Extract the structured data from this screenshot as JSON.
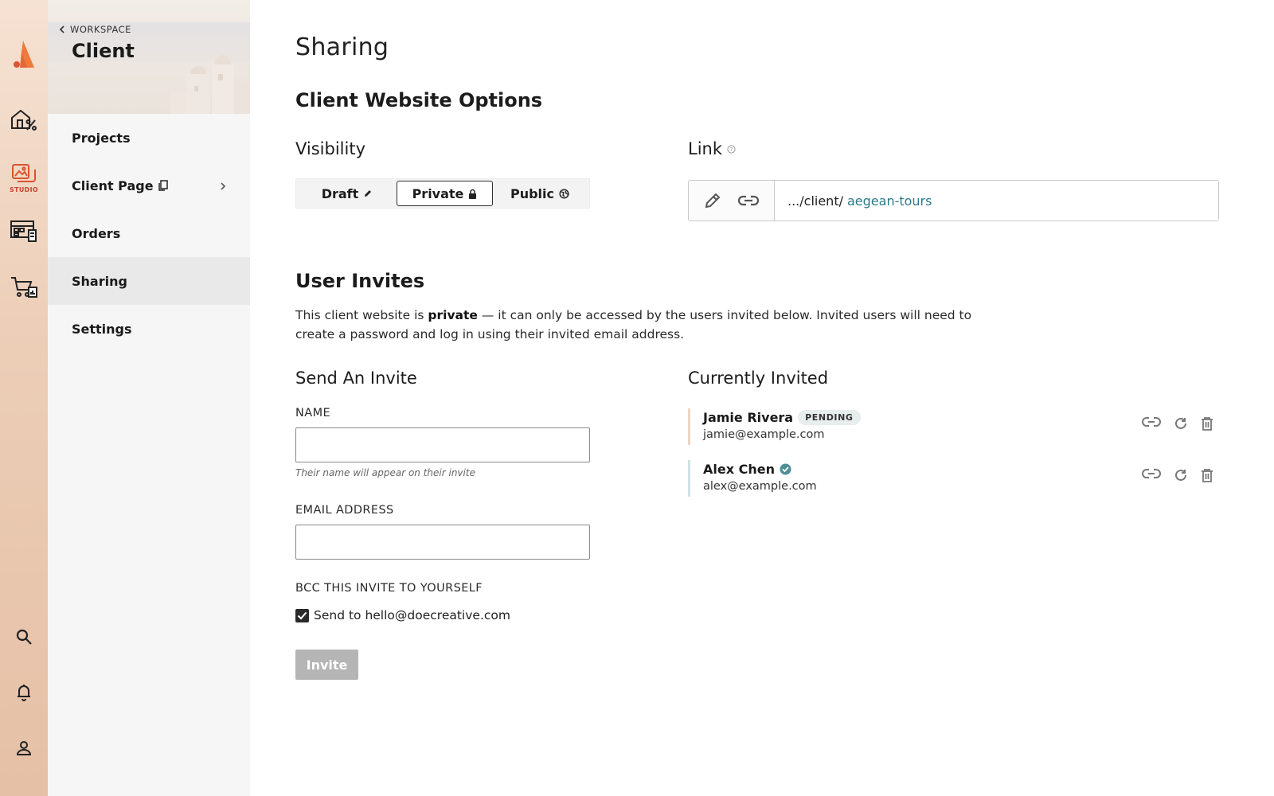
{
  "rail": {
    "studio_label": "STUDIO"
  },
  "sidebar": {
    "back_label": "WORKSPACE",
    "title": "Client",
    "items": [
      {
        "label": "Projects"
      },
      {
        "label": "Client Page"
      },
      {
        "label": "Orders"
      },
      {
        "label": "Sharing"
      },
      {
        "label": "Settings"
      }
    ],
    "active": "Sharing"
  },
  "main": {
    "page_title": "Sharing",
    "options_heading": "Client Website Options",
    "visibility": {
      "heading": "Visibility",
      "options": [
        {
          "label": "Draft",
          "icon": "pencil-icon"
        },
        {
          "label": "Private",
          "icon": "lock-icon"
        },
        {
          "label": "Public",
          "icon": "globe-icon"
        }
      ],
      "selected": "Private"
    },
    "link": {
      "heading": "Link",
      "prefix": ".../client/",
      "slug": "aegean-tours"
    },
    "invites": {
      "heading": "User Invites",
      "desc_pre": "This client website is ",
      "desc_bold": "private",
      "desc_post": " — it can only be accessed by the users invited below. Invited users will need to create a password and log in using their invited email address."
    },
    "send": {
      "heading": "Send An Invite",
      "name_label": "NAME",
      "name_value": "",
      "name_hint": "Their name will appear on their invite",
      "email_label": "EMAIL ADDRESS",
      "email_value": "",
      "bcc_label": "BCC THIS INVITE TO YOURSELF",
      "bcc_checked": true,
      "bcc_text": "Send to hello@doecreative.com",
      "invite_button": "Invite"
    },
    "current": {
      "heading": "Currently Invited",
      "users": [
        {
          "name": "Jamie Rivera",
          "status": "PENDING",
          "email": "jamie@example.com"
        },
        {
          "name": "Alex Chen",
          "status": "verified",
          "email": "alex@example.com"
        }
      ]
    }
  },
  "colors": {
    "accent": "#d9542f",
    "slug": "#2b7a8a",
    "verified": "#4f8f94",
    "button_disabled": "#b5b5b5"
  }
}
